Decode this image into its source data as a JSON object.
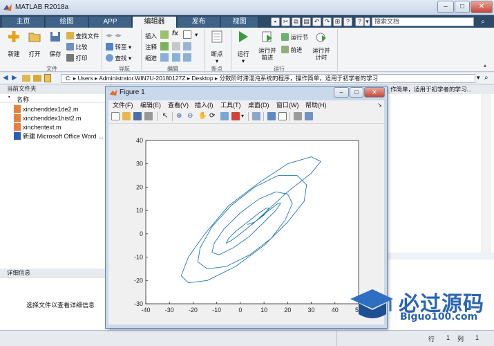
{
  "window": {
    "title": "MATLAB R2018a",
    "controls": [
      "–",
      "□",
      "✕"
    ]
  },
  "tabs": [
    {
      "label": "主页",
      "active": false
    },
    {
      "label": "绘图",
      "active": false
    },
    {
      "label": "APP",
      "active": false
    },
    {
      "label": "编辑器",
      "active": true
    },
    {
      "label": "发布",
      "active": false
    },
    {
      "label": "视图",
      "active": false
    }
  ],
  "search": {
    "placeholder": "搜索文档"
  },
  "ribbon": {
    "groups": {
      "file": "文件",
      "navigate": "导航",
      "edit": "编辑",
      "breakpoints": "断点",
      "run": "运行"
    },
    "new": "新建",
    "open": "打开",
    "save": "保存",
    "find_files": "查找文件",
    "compare": "比较",
    "print": "打印",
    "goto": "转至",
    "find": "查找",
    "insert": "插入",
    "comment": "注释",
    "indent": "缩进",
    "fx": "fx",
    "breakpoint": "断点",
    "run": "运行",
    "run_advance": "运行并\n前进",
    "run_section": "运行节",
    "advance": "前进",
    "run_time": "运行并\n计时"
  },
  "address": {
    "path": "C: ▸ Users ▸ Administrator.WIN7U-20180127Z ▸ Desktop ▸ 分数阶时滞混沌系统的程序，操作简单，适用于初学者的学习"
  },
  "current_folder": {
    "header": "当前文件夹",
    "column_name": "名称",
    "files": [
      {
        "name": "xinchenddex1de2.m",
        "type": "m"
      },
      {
        "name": "xinchenddex1hist2.m",
        "type": "m"
      },
      {
        "name": "xinchentext.m",
        "type": "m"
      },
      {
        "name": "新建 Microsoft Office Word ...",
        "type": "doc"
      }
    ]
  },
  "details": {
    "header": "详细信息",
    "hint": "选择文件以查看详细信息"
  },
  "right_panel_header": "作简单，适用于初学者的学习...",
  "status": {
    "row_label": "行",
    "row_value": "1",
    "col_label": "列",
    "col_value": "1"
  },
  "figure": {
    "title": "Figure 1",
    "menu": [
      "文件(F)",
      "编辑(E)",
      "查看(V)",
      "插入(I)",
      "工具(T)",
      "桌面(D)",
      "窗口(W)",
      "帮助(H)"
    ]
  },
  "chart_data": {
    "type": "line",
    "title": "",
    "xlabel": "",
    "ylabel": "",
    "xlim": [
      -40,
      50
    ],
    "ylim": [
      -30,
      40
    ],
    "xticks": [
      -40,
      -30,
      -20,
      -10,
      0,
      10,
      20,
      30,
      40,
      50
    ],
    "yticks": [
      -30,
      -20,
      -10,
      0,
      10,
      20,
      30,
      40
    ],
    "grid": false,
    "series": [
      {
        "color": "#1f77b4",
        "description_points": "spiral trajectory around (5,5), rotated ellipse major axis along y≈x; outer loop reaches x≈-25..40, y≈-21..32",
        "x": [
          5,
          20,
          30,
          34,
          30,
          20,
          8,
          -5,
          -15,
          -22,
          -25,
          -22,
          -14,
          -2,
          10,
          20,
          27,
          28,
          24,
          16,
          6,
          -4,
          -12,
          -17,
          -18,
          -14,
          -6,
          4,
          13,
          19,
          22,
          20,
          15,
          8,
          0,
          -7,
          -11,
          -12,
          -9,
          -3,
          4,
          10,
          15,
          17,
          16,
          12,
          6,
          0,
          -4,
          -6,
          -5,
          -2,
          3,
          8,
          11,
          12,
          10,
          6,
          3
        ],
        "y": [
          4,
          18,
          26,
          31,
          33,
          30,
          22,
          12,
          0,
          -10,
          -18,
          -21,
          -20,
          -14,
          -5,
          5,
          14,
          21,
          25,
          25,
          20,
          12,
          3,
          -6,
          -12,
          -15,
          -14,
          -9,
          -2,
          6,
          13,
          17,
          18,
          15,
          9,
          2,
          -4,
          -8,
          -9,
          -6,
          -1,
          5,
          10,
          13,
          13,
          10,
          5,
          0,
          -3,
          -4,
          -2,
          1,
          5,
          9,
          11,
          11,
          8,
          5,
          4
        ]
      }
    ]
  },
  "watermark": {
    "title": "必过源码",
    "url": "Biguo100.com"
  }
}
